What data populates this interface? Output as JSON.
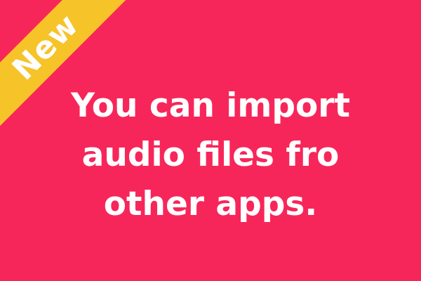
{
  "colors": {
    "background": "#f7265a",
    "ribbon": "#f6c329",
    "text": "#ffffff"
  },
  "badge": {
    "label": "New"
  },
  "message": {
    "lines": [
      "You can import",
      "audio files fro",
      "other apps."
    ]
  }
}
